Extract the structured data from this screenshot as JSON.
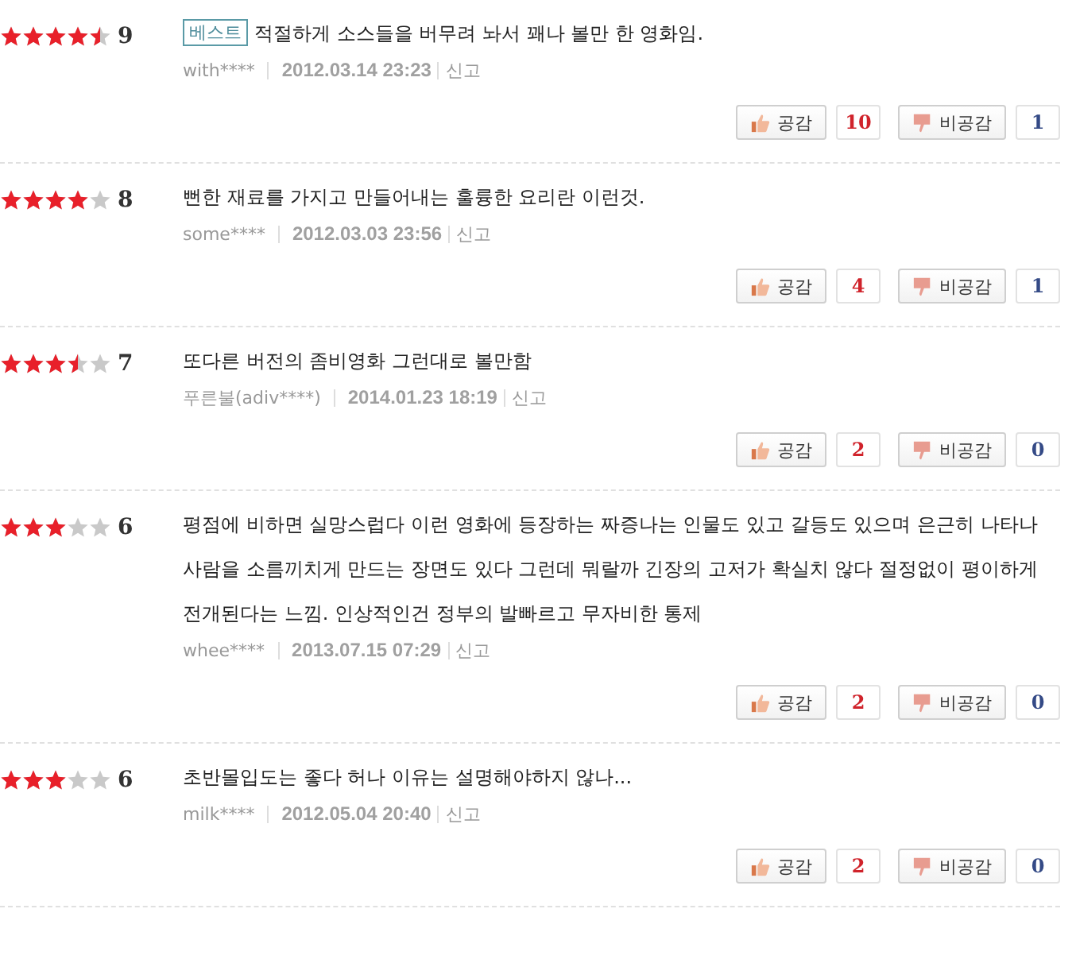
{
  "reviews": [
    {
      "stars": 4.5,
      "score": "9",
      "badge": "베스트",
      "text": "적절하게 소스들을 버무려 놔서 꽤나 볼만 한 영화임.",
      "author": "with****",
      "date": "2012.03.14 23:23",
      "report": "신고",
      "like_label": "공감",
      "like_count": "10",
      "dislike_label": "비공감",
      "dislike_count": "1"
    },
    {
      "stars": 4,
      "score": "8",
      "text": "뻔한 재료를 가지고 만들어내는 훌륭한 요리란 이런것.",
      "author": "some****",
      "date": "2012.03.03 23:56",
      "report": "신고",
      "like_label": "공감",
      "like_count": "4",
      "dislike_label": "비공감",
      "dislike_count": "1"
    },
    {
      "stars": 3.5,
      "score": "7",
      "text": "또다른 버전의 좀비영화 그런대로 볼만함",
      "author": "푸른불(adiv****)",
      "date": "2014.01.23 18:19",
      "report": "신고",
      "like_label": "공감",
      "like_count": "2",
      "dislike_label": "비공감",
      "dislike_count": "0"
    },
    {
      "stars": 3,
      "score": "6",
      "text": "평점에 비하면 실망스럽다 이런 영화에 등장하는 짜증나는 인물도 있고 갈등도 있으며 은근히 나타나 사람을 소름끼치게 만드는 장면도 있다 그런데 뭐랄까 긴장의 고저가 확실치 않다 절정없이 평이하게 전개된다는 느낌. 인상적인건 정부의 발빠르고 무자비한 통제",
      "author": "whee****",
      "date": "2013.07.15 07:29",
      "report": "신고",
      "like_label": "공감",
      "like_count": "2",
      "dislike_label": "비공감",
      "dislike_count": "0"
    },
    {
      "stars": 3,
      "score": "6",
      "text": "초반몰입도는 좋다 허나 이유는 설명해야하지 않나...",
      "author": "milk****",
      "date": "2012.05.04 20:40",
      "report": "신고",
      "like_label": "공감",
      "like_count": "2",
      "dislike_label": "비공감",
      "dislike_count": "0"
    }
  ]
}
